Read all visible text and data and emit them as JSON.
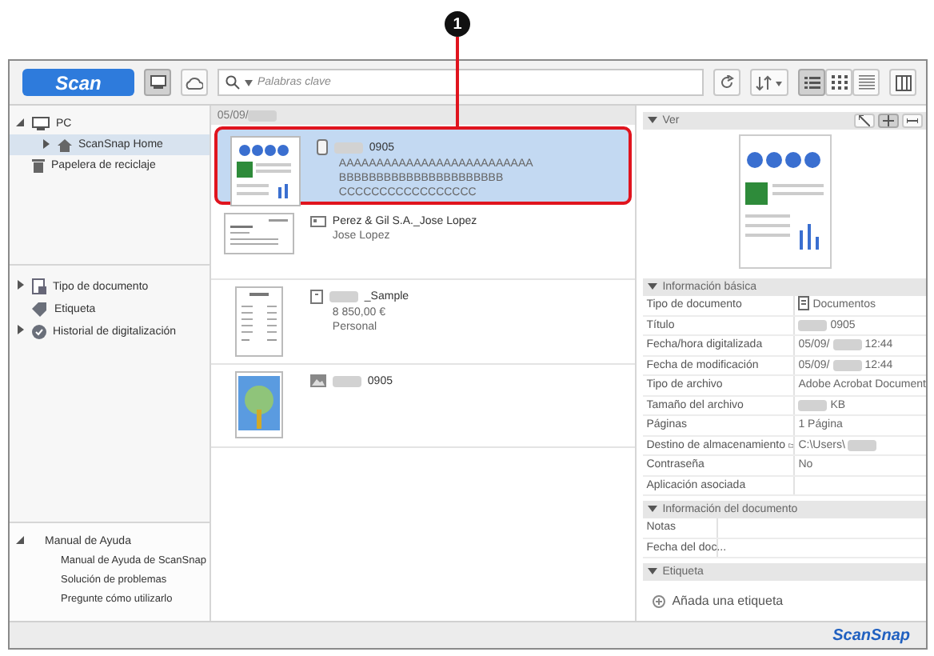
{
  "callout": {
    "label": "1"
  },
  "toolbar": {
    "scan_button": "Scan",
    "search": {
      "placeholder": "Palabras clave"
    },
    "view_modes": [
      {
        "kind": "list",
        "selected": true
      },
      {
        "kind": "grid",
        "selected": false
      },
      {
        "kind": "lines",
        "selected": false
      }
    ]
  },
  "sidebar": {
    "tree": [
      {
        "label": "PC",
        "kind": "pc",
        "expanded": true,
        "selected": false,
        "children": [
          {
            "label": "ScanSnap Home",
            "kind": "home",
            "expanded": false,
            "selected": true
          }
        ]
      },
      {
        "label": "Papelera de reciclaje",
        "kind": "trash",
        "selected": false
      }
    ],
    "categories": [
      {
        "label": "Tipo de documento",
        "kind": "doctype",
        "expandable": true
      },
      {
        "label": "Etiqueta",
        "kind": "tag",
        "expandable": false
      },
      {
        "label": "Historial de digitalización",
        "kind": "history",
        "expandable": true
      }
    ],
    "help": {
      "label": "Manual de Ayuda",
      "expanded": true,
      "links": [
        "Manual de Ayuda de ScanSnap",
        "Solución de problemas",
        "Pregunte cómo utilizarlo"
      ]
    }
  },
  "list": {
    "date_header": [
      {
        "kind": "text",
        "text": "05/09/"
      },
      {
        "kind": "redacted"
      }
    ],
    "items": [
      {
        "kind": "document",
        "selected": true,
        "title": [
          {
            "kind": "redacted"
          },
          {
            "kind": "text",
            "text": "0905"
          }
        ],
        "lines": [
          "AAAAAAAAAAAAAAAAAAAAAAAAAA",
          "BBBBBBBBBBBBBBBBBBBBBB",
          "CCCCCCCCCCCCCCCCC"
        ]
      },
      {
        "kind": "card",
        "selected": false,
        "title": [
          {
            "kind": "text",
            "text": "Perez & Gil S.A._Jose Lopez"
          }
        ],
        "lines": [
          "Jose Lopez"
        ]
      },
      {
        "kind": "receipt",
        "selected": false,
        "title": [
          {
            "kind": "redacted"
          },
          {
            "kind": "text",
            "text": "_Sample"
          }
        ],
        "lines": [
          "8 850,00 €",
          "Personal"
        ]
      },
      {
        "kind": "photo",
        "selected": false,
        "title": [
          {
            "kind": "redacted"
          },
          {
            "kind": "text",
            "text": "0905"
          }
        ]
      }
    ]
  },
  "details": {
    "preview": {
      "title": "Ver"
    },
    "sections": [
      {
        "title": "Información básica",
        "expanded": true,
        "rows": [
          {
            "label": "Tipo de documento",
            "value": [
              {
                "kind": "icon"
              },
              {
                "kind": "text",
                "text": "Documentos"
              }
            ]
          },
          {
            "label": "Título",
            "value": [
              {
                "kind": "redacted"
              },
              {
                "kind": "text",
                "text": "0905"
              }
            ]
          },
          {
            "label": "Fecha/hora digitalizada",
            "value": [
              {
                "kind": "text",
                "text": "05/09/"
              },
              {
                "kind": "redacted"
              },
              {
                "kind": "text",
                "text": "12:44"
              }
            ]
          },
          {
            "label": "Fecha de modificación",
            "value": [
              {
                "kind": "text",
                "text": "05/09/"
              },
              {
                "kind": "redacted"
              },
              {
                "kind": "text",
                "text": "12:44"
              }
            ]
          },
          {
            "label": "Tipo de archivo",
            "value": [
              {
                "kind": "text",
                "text": "Adobe Acrobat Document"
              }
            ]
          },
          {
            "label": "Tamaño del archivo",
            "value": [
              {
                "kind": "redacted"
              },
              {
                "kind": "text",
                "text": "KB"
              }
            ]
          },
          {
            "label": "Páginas",
            "value": [
              {
                "kind": "text",
                "text": "1 Página"
              }
            ]
          },
          {
            "label": "Destino de almacenamiento",
            "folder": true,
            "value": [
              {
                "kind": "text",
                "text": "C:\\Users\\"
              },
              {
                "kind": "redacted"
              }
            ]
          },
          {
            "label": "Contraseña",
            "value": [
              {
                "kind": "text",
                "text": "No"
              }
            ]
          },
          {
            "label": "Aplicación asociada"
          }
        ]
      },
      {
        "title": "Información del documento",
        "expanded": true,
        "narrow": true,
        "rows": [
          {
            "label": "Notas"
          },
          {
            "label": "Fecha del doc..."
          }
        ]
      },
      {
        "title": "Etiqueta",
        "expanded": true,
        "add_label": "Añada una etiqueta"
      }
    ]
  },
  "status_bar": {
    "logo": "ScanSnap"
  }
}
